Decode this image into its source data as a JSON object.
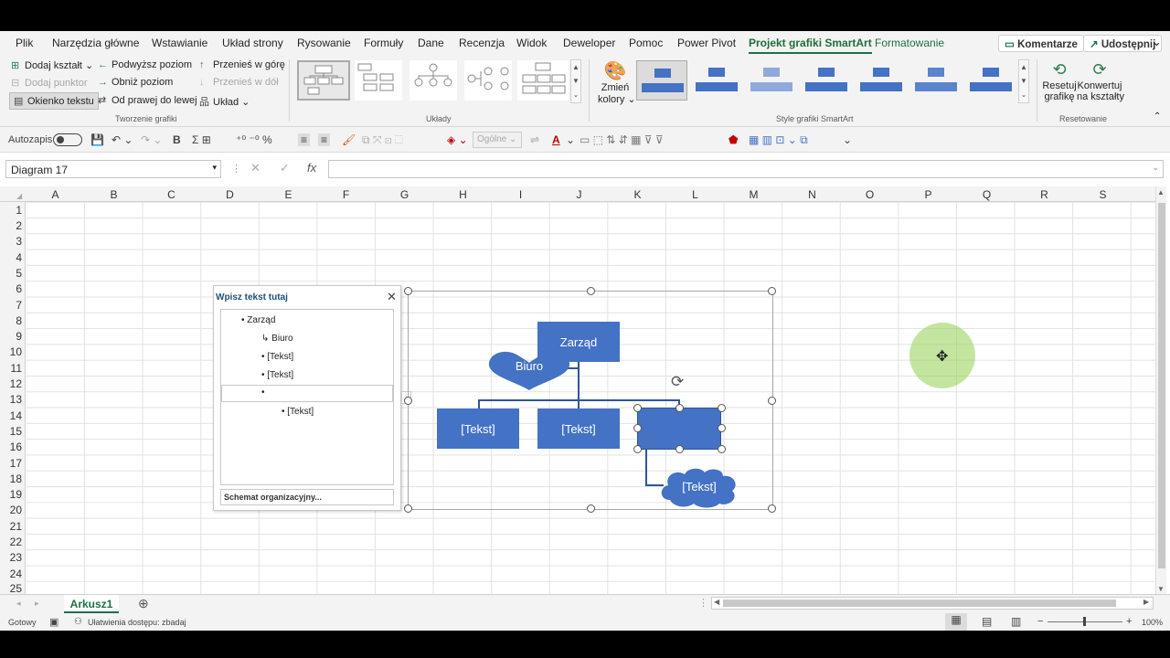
{
  "tabs": [
    "Plik",
    "Narzędzia główne",
    "Wstawianie",
    "Układ strony",
    "Rysowanie",
    "Formuły",
    "Dane",
    "Recenzja",
    "Widok",
    "Deweloper",
    "Pomoc",
    "Power Pivot",
    "Projekt grafiki SmartArt",
    "Formatowanie"
  ],
  "comments_label": "Komentarze",
  "share_label": "Udostępnij",
  "ribbon": {
    "create_graphic": {
      "add_shape": "Dodaj kształt",
      "add_bullet": "Dodaj punktor",
      "text_pane": "Okienko tekstu",
      "promote": "Podwyższ poziom",
      "demote": "Obniż poziom",
      "rtl": "Od prawej do lewej",
      "move_up": "Przenieś w górę",
      "move_down": "Przenieś w dół",
      "layout": "Układ",
      "group_label": "Tworzenie grafiki"
    },
    "layouts_label": "Układy",
    "change_colors": [
      "Zmień",
      "kolory"
    ],
    "styles_label": "Style grafiki SmartArt",
    "reset_graphic": [
      "Resetuj",
      "grafikę"
    ],
    "convert_shapes": [
      "Konwertuj",
      "na kształty"
    ],
    "reset_label": "Resetowanie"
  },
  "qat": {
    "autosave": "Autozapis",
    "number_format": "Ogólne"
  },
  "namebox": "Diagram 17",
  "columns": [
    "A",
    "B",
    "C",
    "D",
    "E",
    "F",
    "G",
    "H",
    "I",
    "J",
    "K",
    "L",
    "M",
    "N",
    "O",
    "P",
    "Q",
    "R",
    "S"
  ],
  "rows": [
    "1",
    "2",
    "3",
    "4",
    "5",
    "6",
    "7",
    "8",
    "9",
    "10",
    "11",
    "12",
    "13",
    "14",
    "15",
    "16",
    "17",
    "18",
    "19",
    "20",
    "21",
    "22",
    "23",
    "24",
    "25"
  ],
  "text_pane": {
    "title": "Wpisz tekst tutaj",
    "items": [
      "Zarząd",
      "Biuro",
      "[Tekst]",
      "[Tekst]",
      "",
      "[Tekst]"
    ],
    "footer": "Schemat organizacyjny..."
  },
  "diagram": {
    "top": "Zarząd",
    "assistant": "Biuro",
    "child1": "[Tekst]",
    "child2": "[Tekst]",
    "child3": "",
    "sub": "[Tekst]",
    "color": "#4472c4"
  },
  "sheet_tab": "Arkusz1",
  "status": {
    "ready": "Gotowy",
    "accessibility": "Ułatwienia dostępu: zbadaj",
    "zoom": "100%"
  }
}
